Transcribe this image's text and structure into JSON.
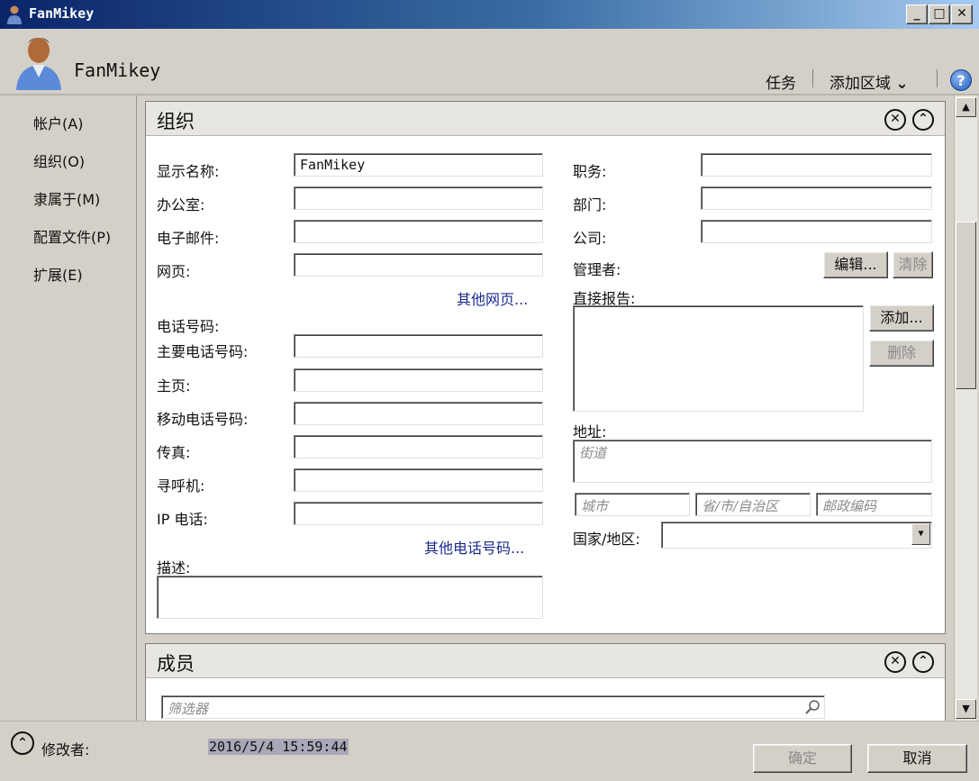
{
  "window": {
    "title": "FanMikey"
  },
  "header": {
    "user_name": "FanMikey",
    "tasks": "任务",
    "add_area": "添加区域",
    "help": "?"
  },
  "sidebar": {
    "items": [
      "帐户(A)",
      "组织(O)",
      "隶属于(M)",
      "配置文件(P)",
      "扩展(E)"
    ]
  },
  "org": {
    "title": "组织",
    "display_name_label": "显示名称:",
    "display_name_value": "FanMikey",
    "office_label": "办公室:",
    "email_label": "电子邮件:",
    "webpage_label": "网页:",
    "other_webpages": "其他网页...",
    "phone_header": "电话号码:",
    "main_phone_label": "主要电话号码:",
    "home_label": "主页:",
    "mobile_label": "移动电话号码:",
    "fax_label": "传真:",
    "pager_label": "寻呼机:",
    "ip_phone_label": "IP 电话:",
    "other_phones": "其他电话号码...",
    "description_label": "描述:",
    "job_title_label": "职务:",
    "department_label": "部门:",
    "company_label": "公司:",
    "manager_label": "管理者:",
    "edit_button": "编辑...",
    "clear_button": "清除",
    "direct_reports_label": "直接报告:",
    "add_button": "添加...",
    "remove_button": "删除",
    "address_label": "地址:",
    "street_placeholder": "街道",
    "city_placeholder": "城市",
    "state_placeholder": "省/市/自治区",
    "zip_placeholder": "邮政编码",
    "country_label": "国家/地区:"
  },
  "members": {
    "title": "成员",
    "filter_placeholder": "筛选器"
  },
  "footer": {
    "modified_by_label": "修改者:",
    "modified_time": "2016/5/4 15:59:44",
    "ok": "确定",
    "cancel": "取消"
  }
}
